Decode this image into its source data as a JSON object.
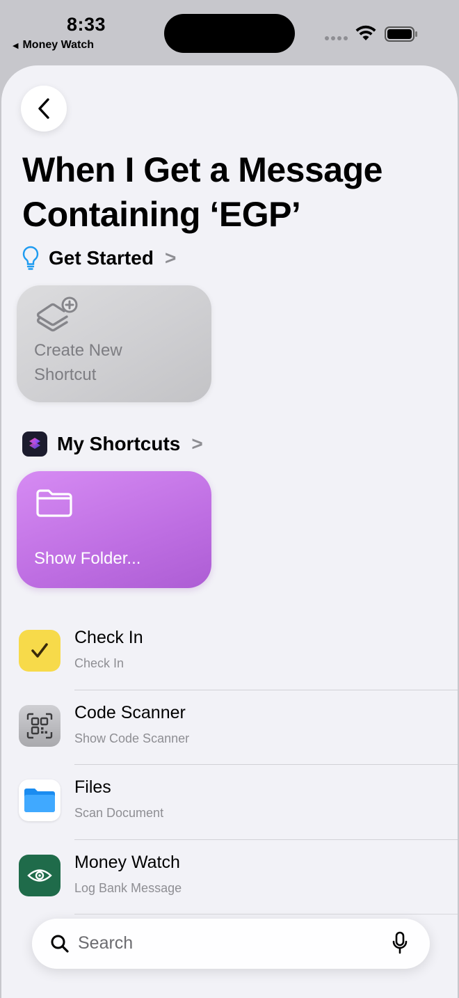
{
  "status_bar": {
    "time": "8:33",
    "back_app": "Money Watch"
  },
  "page": {
    "title_line1": "When I Get a Message",
    "title_line2": "Containing ‘EGP’"
  },
  "get_started": {
    "label": "Get Started",
    "chevron": ">",
    "card_line1": "Create New",
    "card_line2": "Shortcut"
  },
  "my_shortcuts": {
    "label": "My Shortcuts",
    "chevron": ">",
    "folder_card": "Show Folder..."
  },
  "actions": [
    {
      "name": "Check In",
      "subtitle": "Check In",
      "icon": "checkmark-icon",
      "color": "#f7da4a"
    },
    {
      "name": "Code Scanner",
      "subtitle": "Show Code Scanner",
      "icon": "qr-code-icon",
      "color": "#b9b9bd"
    },
    {
      "name": "Files",
      "subtitle": "Scan Document",
      "icon": "folder-icon",
      "color": "#ffffff"
    },
    {
      "name": "Money Watch",
      "subtitle": "Log Bank Message",
      "icon": "eye-icon",
      "color": "#1f6b4a"
    }
  ],
  "search": {
    "placeholder": "Search"
  },
  "colors": {
    "accent": "#007aff",
    "folder_card": "#c776e8",
    "background": "#f2f2f7"
  }
}
